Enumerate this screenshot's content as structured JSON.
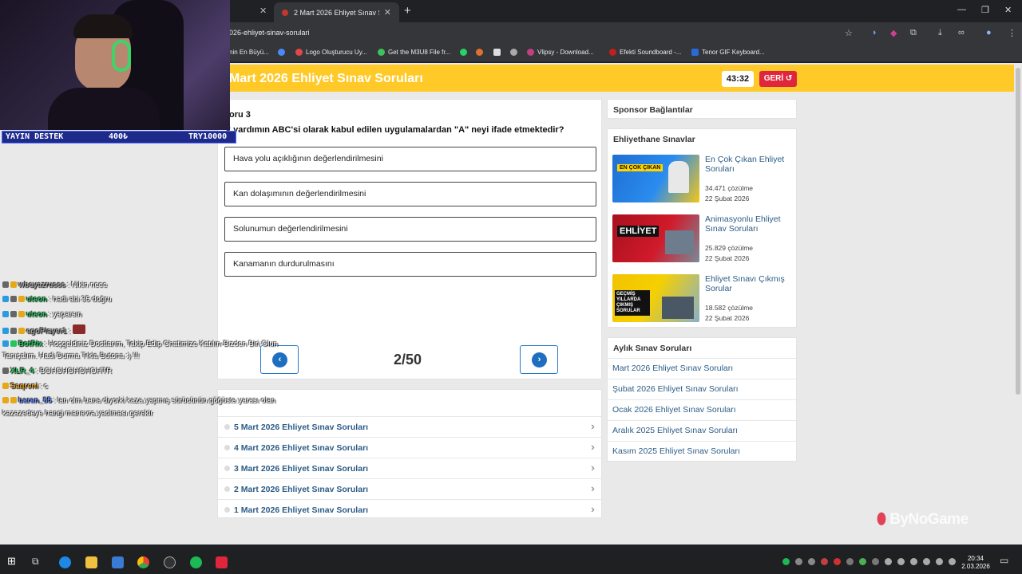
{
  "browser": {
    "active_tab_title": "2 Mart 2026 Ehliyet Sınav Soruları",
    "url": "026-ehliyet-sinav-sorulari",
    "bookmarks": [
      "nin En Büyü...",
      "Logo Oluşturucu Uy...",
      "Get the M3U8 File fr...",
      "Vlipsy - Download...",
      "Efekti Soundboard -...",
      "Tenor GIF Keyboard..."
    ]
  },
  "header": {
    "title": "Mart 2026 Ehliyet Sınav Soruları",
    "timer": "43:32",
    "back_label": "GERİ"
  },
  "question": {
    "number_label": "oru 3",
    "text": "k yardımın ABC'si olarak kabul edilen uygulamalardan \"A\" neyi ifade etmektedir?",
    "options": [
      "Hava yolu açıklığının değerlendirilmesini",
      "Kan dolaşımının değerlendirilmesini",
      "Solunumun değerlendirilmesini",
      "Kanamanın durdurulmasını"
    ],
    "counter": "2/50"
  },
  "related": {
    "items": [
      "5 Mart 2026 Ehliyet Sınav Soruları",
      "4 Mart 2026 Ehliyet Sınav Soruları",
      "3 Mart 2026 Ehliyet Sınav Soruları",
      "2 Mart 2026 Ehliyet Sınav Soruları",
      "1 Mart 2026 Ehliyet Sınav Soruları"
    ]
  },
  "sidebar": {
    "sponsor_title": "Sponsor Bağlantılar",
    "exams_title": "Ehliyethane Sınavlar",
    "promos": [
      {
        "title": "En Çok Çıkan Ehliyet Soruları",
        "count": "34.471 çözülme",
        "date": "22 Şubat 2026",
        "thumb_text": "EN ÇOK ÇIKAN"
      },
      {
        "title": "Animasyonlu Ehliyet Sınav Soruları",
        "count": "25.829 çözülme",
        "date": "22 Şubat 2026",
        "thumb_text": "EHLİYET"
      },
      {
        "title": "Ehliyet Sınavı Çıkmış Sorular",
        "count": "18.582 çözülme",
        "date": "22 Şubat 2026",
        "thumb_text": "GEÇMİŞ YILLARDA ÇIKMIŞ SORULAR"
      }
    ],
    "monthly_title": "Aylık Sınav Soruları",
    "monthly": [
      "Mart 2026 Ehliyet Sınav Soruları",
      "Şubat 2026 Ehliyet Sınav Soruları",
      "Ocak 2026 Ehliyet Sınav Soruları",
      "Aralık 2025 Ehliyet Sınav Soruları",
      "Kasım 2025 Ehliyet Sınav Soruları"
    ]
  },
  "stream": {
    "donate": {
      "left": "YAYIN DESTEK",
      "mid": "400₺",
      "right": "TRY10000"
    },
    "chat": [
      {
        "user": "wbeyazrusss",
        "color": "#a0a0a0",
        "msg": ": Nikin neee"
      },
      {
        "user": "uteon",
        "color": "#22c55e",
        "msg": ": hadi abi 35 doğru"
      },
      {
        "user": "uteon",
        "color": "#22c55e",
        "msg": ": yaparsın"
      },
      {
        "user": "egoPlayer1",
        "color": "#a0a0a0",
        "msg": ":"
      },
      {
        "user": "BotRix",
        "color": "#22c55e",
        "msg": ": Hoşgeldiniz Dostlarım, Takip Edip Chatimize Katılın-Bizden Biri Olun"
      },
      {
        "user": "",
        "color": "#ffffff",
        "msg": "Tanışalım. Hadi Durma Tıkla Butona :) !!!"
      },
      {
        "user": "XLR_4",
        "color": "#22c55e",
        "msg": ": BOHOHOHOHOHTR"
      },
      {
        "user": "Saqreni",
        "color": "#e0a030",
        "msg": ": c"
      },
      {
        "user": "baran_85",
        "color": "#6b8cff",
        "msg": ": lan olm bana diyorki kaza yapmış sürücünün göğüste yarası olan"
      },
      {
        "user": "",
        "color": "#ffffff",
        "msg": "kazazedeye hangi manevra yaolması gerekir"
      }
    ],
    "watermark": "ByNoGame"
  },
  "taskbar": {
    "time": "20:34",
    "date": "2.03.2026"
  }
}
